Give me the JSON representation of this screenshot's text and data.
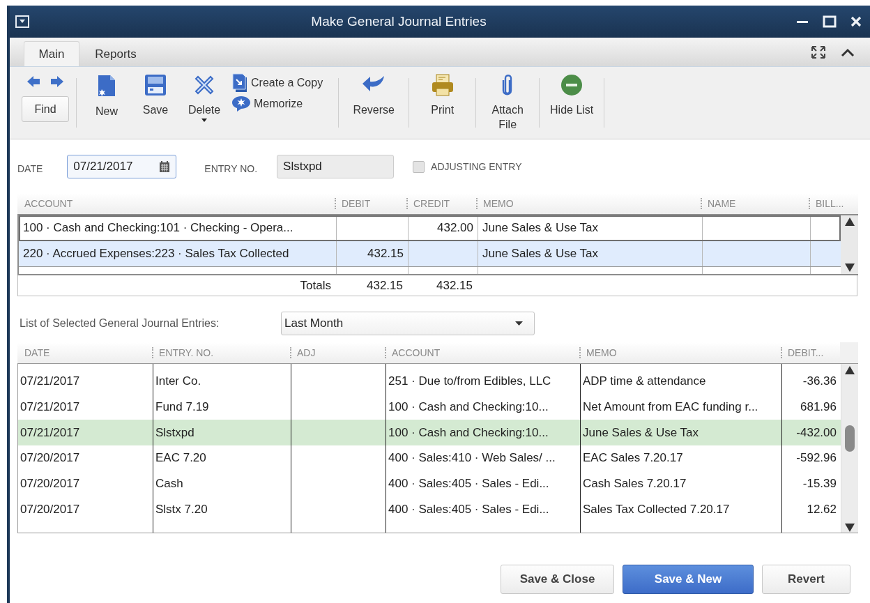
{
  "window": {
    "title": "Make General Journal Entries"
  },
  "tabs": [
    {
      "label": "Main",
      "selected": true
    },
    {
      "label": "Reports",
      "selected": false
    }
  ],
  "toolbar": {
    "find": "Find",
    "new": "New",
    "save": "Save",
    "delete": "Delete",
    "create_copy": "Create a Copy",
    "memorize": "Memorize",
    "reverse": "Reverse",
    "print": "Print",
    "attach_file": "Attach File",
    "hide_list": "Hide List"
  },
  "form": {
    "date_label": "DATE",
    "date": "07/21/2017",
    "entry_no_label": "ENTRY NO.",
    "entry_no": "Slstxpd",
    "adjusting": {
      "label": "ADJUSTING ENTRY",
      "checked": false
    }
  },
  "entry_table": {
    "columns": [
      "ACCOUNT",
      "DEBIT",
      "CREDIT",
      "MEMO",
      "NAME",
      "BILL..."
    ],
    "rows": [
      {
        "account": "100 · Cash and Checking:101 · Checking - Opera...",
        "credit": "432.00",
        "memo": "June Sales & Use Tax",
        "focused": true,
        "selected": false
      },
      {
        "account": "220 · Accrued Expenses:223 · Sales Tax Collected",
        "debit": "432.15",
        "memo": "June Sales & Use Tax",
        "focused": false,
        "selected": true
      }
    ],
    "totals": {
      "label": "Totals",
      "debit": "432.15",
      "credit": "432.15"
    }
  },
  "list": {
    "label": "List of Selected General Journal Entries:",
    "filter": "Last Month",
    "columns": [
      "DATE",
      "ENTRY. NO.",
      "ADJ",
      "ACCOUNT",
      "MEMO",
      "DEBIT..."
    ],
    "rows": [
      {
        "date": "07/21/2017",
        "entry_no": "Inter Co.",
        "account": "251 · Due to/from Edibles, LLC",
        "memo": "ADP time & attendance",
        "debit": "-36.36",
        "selected": false
      },
      {
        "date": "07/21/2017",
        "entry_no": "Fund 7.19",
        "account": "100 · Cash and Checking:10...",
        "memo": "Net Amount from EAC funding r...",
        "debit": "681.96",
        "selected": false
      },
      {
        "date": "07/21/2017",
        "entry_no": "Slstxpd",
        "account": "100 · Cash and Checking:10...",
        "memo": "June Sales & Use Tax",
        "debit": "-432.00",
        "selected": true
      },
      {
        "date": "07/20/2017",
        "entry_no": "EAC 7.20",
        "account": "400 · Sales:410 · Web Sales/ ...",
        "memo": "EAC Sales 7.20.17",
        "debit": "-592.96",
        "selected": false
      },
      {
        "date": "07/20/2017",
        "entry_no": "Cash",
        "account": "400 · Sales:405 · Sales - Edi...",
        "memo": "Cash Sales 7.20.17",
        "debit": "-15.39",
        "selected": false
      },
      {
        "date": "07/20/2017",
        "entry_no": "Slstx 7.20",
        "account": "400 · Sales:405 · Sales - Edi...",
        "memo": "Sales Tax Collected  7.20.17",
        "debit": "12.62",
        "selected": false
      }
    ]
  },
  "buttons": [
    {
      "label": "Save & Close",
      "primary": false
    },
    {
      "label": "Save & New",
      "primary": true
    },
    {
      "label": "Revert",
      "primary": false
    }
  ]
}
